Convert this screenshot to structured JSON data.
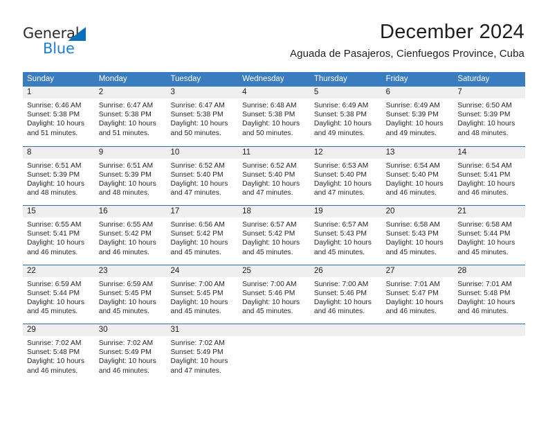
{
  "brand": {
    "word_top": "General",
    "word_bottom": "Blue",
    "triangle_color": "#0c6fba",
    "blue_color": "#1c7fd4"
  },
  "header": {
    "title": "December 2024",
    "subtitle": "Aguada de Pasajeros, Cienfuegos Province, Cuba"
  },
  "theme": {
    "header_band": "#3a7cc0",
    "row_divider": "#2f6ca8",
    "day_head_bg": "#efefef",
    "text": "#252525"
  },
  "calendar": {
    "weekdays": [
      "Sunday",
      "Monday",
      "Tuesday",
      "Wednesday",
      "Thursday",
      "Friday",
      "Saturday"
    ],
    "weeks": [
      [
        {
          "num": "1",
          "lines": [
            "Sunrise: 6:46 AM",
            "Sunset: 5:38 PM",
            "Daylight: 10 hours",
            "and 51 minutes."
          ]
        },
        {
          "num": "2",
          "lines": [
            "Sunrise: 6:47 AM",
            "Sunset: 5:38 PM",
            "Daylight: 10 hours",
            "and 51 minutes."
          ]
        },
        {
          "num": "3",
          "lines": [
            "Sunrise: 6:47 AM",
            "Sunset: 5:38 PM",
            "Daylight: 10 hours",
            "and 50 minutes."
          ]
        },
        {
          "num": "4",
          "lines": [
            "Sunrise: 6:48 AM",
            "Sunset: 5:38 PM",
            "Daylight: 10 hours",
            "and 50 minutes."
          ]
        },
        {
          "num": "5",
          "lines": [
            "Sunrise: 6:49 AM",
            "Sunset: 5:38 PM",
            "Daylight: 10 hours",
            "and 49 minutes."
          ]
        },
        {
          "num": "6",
          "lines": [
            "Sunrise: 6:49 AM",
            "Sunset: 5:39 PM",
            "Daylight: 10 hours",
            "and 49 minutes."
          ]
        },
        {
          "num": "7",
          "lines": [
            "Sunrise: 6:50 AM",
            "Sunset: 5:39 PM",
            "Daylight: 10 hours",
            "and 48 minutes."
          ]
        }
      ],
      [
        {
          "num": "8",
          "lines": [
            "Sunrise: 6:51 AM",
            "Sunset: 5:39 PM",
            "Daylight: 10 hours",
            "and 48 minutes."
          ]
        },
        {
          "num": "9",
          "lines": [
            "Sunrise: 6:51 AM",
            "Sunset: 5:39 PM",
            "Daylight: 10 hours",
            "and 48 minutes."
          ]
        },
        {
          "num": "10",
          "lines": [
            "Sunrise: 6:52 AM",
            "Sunset: 5:40 PM",
            "Daylight: 10 hours",
            "and 47 minutes."
          ]
        },
        {
          "num": "11",
          "lines": [
            "Sunrise: 6:52 AM",
            "Sunset: 5:40 PM",
            "Daylight: 10 hours",
            "and 47 minutes."
          ]
        },
        {
          "num": "12",
          "lines": [
            "Sunrise: 6:53 AM",
            "Sunset: 5:40 PM",
            "Daylight: 10 hours",
            "and 47 minutes."
          ]
        },
        {
          "num": "13",
          "lines": [
            "Sunrise: 6:54 AM",
            "Sunset: 5:40 PM",
            "Daylight: 10 hours",
            "and 46 minutes."
          ]
        },
        {
          "num": "14",
          "lines": [
            "Sunrise: 6:54 AM",
            "Sunset: 5:41 PM",
            "Daylight: 10 hours",
            "and 46 minutes."
          ]
        }
      ],
      [
        {
          "num": "15",
          "lines": [
            "Sunrise: 6:55 AM",
            "Sunset: 5:41 PM",
            "Daylight: 10 hours",
            "and 46 minutes."
          ]
        },
        {
          "num": "16",
          "lines": [
            "Sunrise: 6:55 AM",
            "Sunset: 5:42 PM",
            "Daylight: 10 hours",
            "and 46 minutes."
          ]
        },
        {
          "num": "17",
          "lines": [
            "Sunrise: 6:56 AM",
            "Sunset: 5:42 PM",
            "Daylight: 10 hours",
            "and 45 minutes."
          ]
        },
        {
          "num": "18",
          "lines": [
            "Sunrise: 6:57 AM",
            "Sunset: 5:42 PM",
            "Daylight: 10 hours",
            "and 45 minutes."
          ]
        },
        {
          "num": "19",
          "lines": [
            "Sunrise: 6:57 AM",
            "Sunset: 5:43 PM",
            "Daylight: 10 hours",
            "and 45 minutes."
          ]
        },
        {
          "num": "20",
          "lines": [
            "Sunrise: 6:58 AM",
            "Sunset: 5:43 PM",
            "Daylight: 10 hours",
            "and 45 minutes."
          ]
        },
        {
          "num": "21",
          "lines": [
            "Sunrise: 6:58 AM",
            "Sunset: 5:44 PM",
            "Daylight: 10 hours",
            "and 45 minutes."
          ]
        }
      ],
      [
        {
          "num": "22",
          "lines": [
            "Sunrise: 6:59 AM",
            "Sunset: 5:44 PM",
            "Daylight: 10 hours",
            "and 45 minutes."
          ]
        },
        {
          "num": "23",
          "lines": [
            "Sunrise: 6:59 AM",
            "Sunset: 5:45 PM",
            "Daylight: 10 hours",
            "and 45 minutes."
          ]
        },
        {
          "num": "24",
          "lines": [
            "Sunrise: 7:00 AM",
            "Sunset: 5:45 PM",
            "Daylight: 10 hours",
            "and 45 minutes."
          ]
        },
        {
          "num": "25",
          "lines": [
            "Sunrise: 7:00 AM",
            "Sunset: 5:46 PM",
            "Daylight: 10 hours",
            "and 45 minutes."
          ]
        },
        {
          "num": "26",
          "lines": [
            "Sunrise: 7:00 AM",
            "Sunset: 5:46 PM",
            "Daylight: 10 hours",
            "and 46 minutes."
          ]
        },
        {
          "num": "27",
          "lines": [
            "Sunrise: 7:01 AM",
            "Sunset: 5:47 PM",
            "Daylight: 10 hours",
            "and 46 minutes."
          ]
        },
        {
          "num": "28",
          "lines": [
            "Sunrise: 7:01 AM",
            "Sunset: 5:48 PM",
            "Daylight: 10 hours",
            "and 46 minutes."
          ]
        }
      ],
      [
        {
          "num": "29",
          "lines": [
            "Sunrise: 7:02 AM",
            "Sunset: 5:48 PM",
            "Daylight: 10 hours",
            "and 46 minutes."
          ]
        },
        {
          "num": "30",
          "lines": [
            "Sunrise: 7:02 AM",
            "Sunset: 5:49 PM",
            "Daylight: 10 hours",
            "and 46 minutes."
          ]
        },
        {
          "num": "31",
          "lines": [
            "Sunrise: 7:02 AM",
            "Sunset: 5:49 PM",
            "Daylight: 10 hours",
            "and 47 minutes."
          ]
        },
        {
          "num": "",
          "lines": []
        },
        {
          "num": "",
          "lines": []
        },
        {
          "num": "",
          "lines": []
        },
        {
          "num": "",
          "lines": []
        }
      ]
    ]
  }
}
